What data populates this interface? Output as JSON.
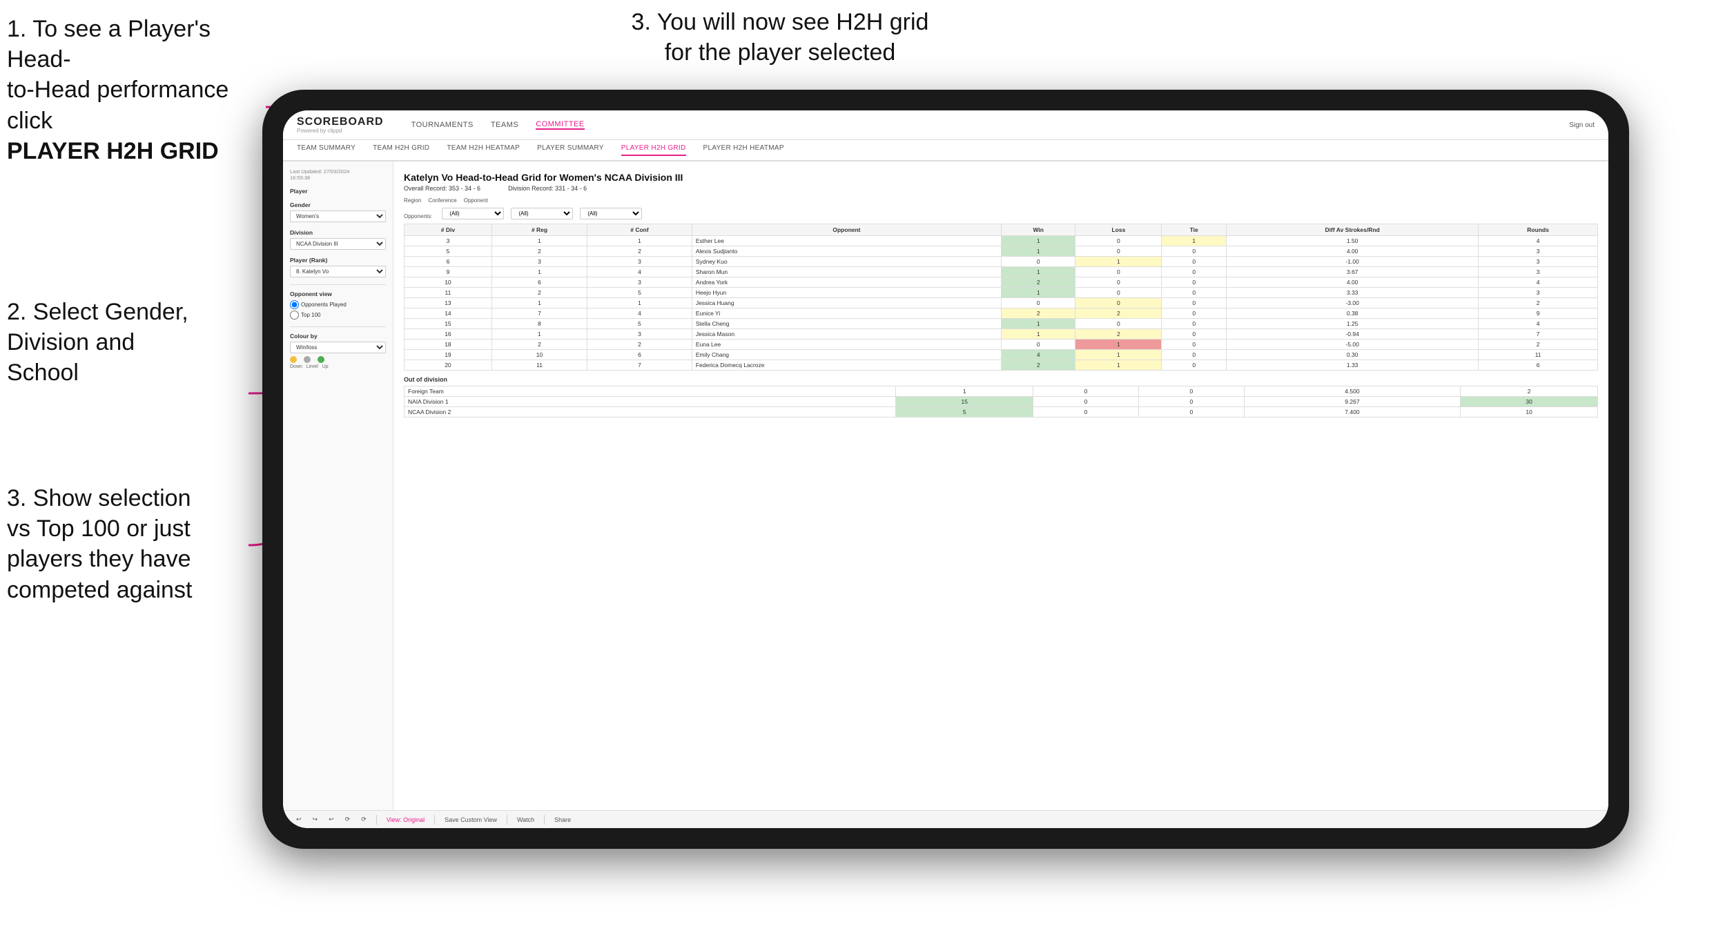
{
  "instructions": {
    "top_left_line1": "1. To see a Player's Head-",
    "top_left_line2": "to-Head performance click",
    "top_left_bold": "PLAYER H2H GRID",
    "top_right": "3. You will now see H2H grid\nfor the player selected",
    "mid_left_line1": "2. Select Gender,",
    "mid_left_line2": "Division and",
    "mid_left_line3": "School",
    "bottom_left_line1": "3. Show selection",
    "bottom_left_line2": "vs Top 100 or just",
    "bottom_left_line3": "players they have",
    "bottom_left_line4": "competed against"
  },
  "nav": {
    "logo": "SCOREBOARD",
    "logo_sub": "Powered by clippd",
    "items": [
      "TOURNAMENTS",
      "TEAMS",
      "COMMITTEE"
    ],
    "sign_out": "Sign out",
    "sub_items": [
      "TEAM SUMMARY",
      "TEAM H2H GRID",
      "TEAM H2H HEATMAP",
      "PLAYER SUMMARY",
      "PLAYER H2H GRID",
      "PLAYER H2H HEATMAP"
    ]
  },
  "sidebar": {
    "updated": "Last Updated: 27/03/2024\n16:55:38",
    "player_label": "Player",
    "gender_label": "Gender",
    "gender_value": "Women's",
    "division_label": "Division",
    "division_value": "NCAA Division III",
    "player_rank_label": "Player (Rank)",
    "player_rank_value": "8. Katelyn Vo",
    "opponent_view_label": "Opponent view",
    "radio1": "Opponents Played",
    "radio2": "Top 100",
    "colour_label": "Colour by",
    "colour_value": "Win/loss",
    "legend": [
      "Down",
      "Level",
      "Up"
    ]
  },
  "grid": {
    "title": "Katelyn Vo Head-to-Head Grid for Women's NCAA Division III",
    "overall_record": "353 - 34 - 6",
    "division_record": "331 - 34 - 6",
    "filter_opponents_label": "Opponents:",
    "filter_opponents_value": "(All)",
    "filter_conference_label": "Conference",
    "filter_conference_value": "(All)",
    "filter_opponent_label": "Opponent",
    "filter_opponent_value": "(All)",
    "headers": [
      "# Div",
      "# Reg",
      "# Conf",
      "Opponent",
      "Win",
      "Loss",
      "Tie",
      "Diff Av Strokes/Rnd",
      "Rounds"
    ],
    "rows": [
      {
        "div": "3",
        "reg": "1",
        "conf": "1",
        "opponent": "Esther Lee",
        "win": "1",
        "loss": "0",
        "tie": "1",
        "diff": "1.50",
        "rounds": "4",
        "win_color": "green",
        "loss_color": "",
        "tie_color": "yellow"
      },
      {
        "div": "5",
        "reg": "2",
        "conf": "2",
        "opponent": "Alexis Sudjianto",
        "win": "1",
        "loss": "0",
        "tie": "0",
        "diff": "4.00",
        "rounds": "3",
        "win_color": "green",
        "loss_color": "",
        "tie_color": ""
      },
      {
        "div": "6",
        "reg": "3",
        "conf": "3",
        "opponent": "Sydney Kuo",
        "win": "0",
        "loss": "1",
        "tie": "0",
        "diff": "-1.00",
        "rounds": "3",
        "win_color": "",
        "loss_color": "yellow",
        "tie_color": ""
      },
      {
        "div": "9",
        "reg": "1",
        "conf": "4",
        "opponent": "Sharon Mun",
        "win": "1",
        "loss": "0",
        "tie": "0",
        "diff": "3.67",
        "rounds": "3",
        "win_color": "green",
        "loss_color": "",
        "tie_color": ""
      },
      {
        "div": "10",
        "reg": "6",
        "conf": "3",
        "opponent": "Andrea York",
        "win": "2",
        "loss": "0",
        "tie": "0",
        "diff": "4.00",
        "rounds": "4",
        "win_color": "green",
        "loss_color": "",
        "tie_color": ""
      },
      {
        "div": "11",
        "reg": "2",
        "conf": "5",
        "opponent": "Heejo Hyun",
        "win": "1",
        "loss": "0",
        "tie": "0",
        "diff": "3.33",
        "rounds": "3",
        "win_color": "green",
        "loss_color": "",
        "tie_color": ""
      },
      {
        "div": "13",
        "reg": "1",
        "conf": "1",
        "opponent": "Jessica Huang",
        "win": "0",
        "loss": "0",
        "tie": "0",
        "diff": "-3.00",
        "rounds": "2",
        "win_color": "",
        "loss_color": "yellow",
        "tie_color": ""
      },
      {
        "div": "14",
        "reg": "7",
        "conf": "4",
        "opponent": "Eunice Yi",
        "win": "2",
        "loss": "2",
        "tie": "0",
        "diff": "0.38",
        "rounds": "9",
        "win_color": "yellow",
        "loss_color": "yellow",
        "tie_color": ""
      },
      {
        "div": "15",
        "reg": "8",
        "conf": "5",
        "opponent": "Stella Cheng",
        "win": "1",
        "loss": "0",
        "tie": "0",
        "diff": "1.25",
        "rounds": "4",
        "win_color": "green",
        "loss_color": "",
        "tie_color": ""
      },
      {
        "div": "16",
        "reg": "1",
        "conf": "3",
        "opponent": "Jessica Mason",
        "win": "1",
        "loss": "2",
        "tie": "0",
        "diff": "-0.94",
        "rounds": "7",
        "win_color": "yellow",
        "loss_color": "yellow",
        "tie_color": ""
      },
      {
        "div": "18",
        "reg": "2",
        "conf": "2",
        "opponent": "Euna Lee",
        "win": "0",
        "loss": "1",
        "tie": "0",
        "diff": "-5.00",
        "rounds": "2",
        "win_color": "",
        "loss_color": "red",
        "tie_color": ""
      },
      {
        "div": "19",
        "reg": "10",
        "conf": "6",
        "opponent": "Emily Chang",
        "win": "4",
        "loss": "1",
        "tie": "0",
        "diff": "0.30",
        "rounds": "11",
        "win_color": "green",
        "loss_color": "yellow",
        "tie_color": ""
      },
      {
        "div": "20",
        "reg": "11",
        "conf": "7",
        "opponent": "Federica Domecq Lacroze",
        "win": "2",
        "loss": "1",
        "tie": "0",
        "diff": "1.33",
        "rounds": "6",
        "win_color": "green",
        "loss_color": "yellow",
        "tie_color": ""
      }
    ],
    "out_of_division_label": "Out of division",
    "out_of_division_rows": [
      {
        "opponent": "Foreign Team",
        "win": "1",
        "loss": "0",
        "tie": "0",
        "diff": "4.500",
        "rounds": "2"
      },
      {
        "opponent": "NAIA Division 1",
        "win": "15",
        "loss": "0",
        "tie": "0",
        "diff": "9.267",
        "rounds": "30"
      },
      {
        "opponent": "NCAA Division 2",
        "win": "5",
        "loss": "0",
        "tie": "0",
        "diff": "7.400",
        "rounds": "10"
      }
    ]
  },
  "toolbar": {
    "view_original": "View: Original",
    "save_custom": "Save Custom View",
    "watch": "Watch",
    "share": "Share"
  }
}
